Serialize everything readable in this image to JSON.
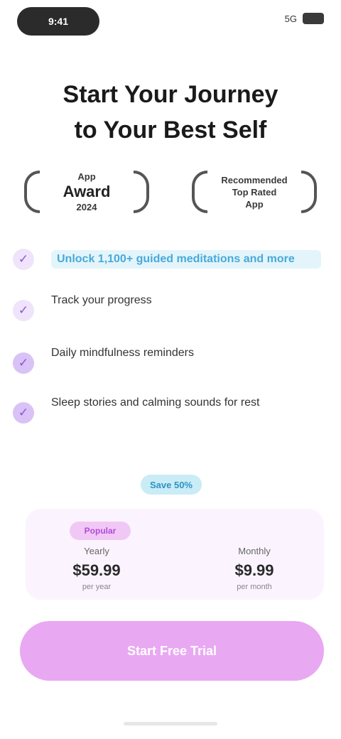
{
  "status_bar": {
    "time": "9:41",
    "signal": "5G"
  },
  "title": {
    "line1": "Start Your Journey",
    "line2": "to Your Best Self"
  },
  "awards": [
    {
      "line1": "App",
      "line2": "Award",
      "line3": "2024"
    },
    {
      "line1": "Recommended",
      "line2": "Top Rated",
      "line3": "App"
    }
  ],
  "features": [
    {
      "text": "Unlock 1,100+ guided meditations and more"
    },
    {
      "text": "Track your progress"
    },
    {
      "text": "Daily mindfulness reminders"
    },
    {
      "text": "Sleep stories and calming sounds for rest"
    }
  ],
  "badge": "Save 50%",
  "plans": [
    {
      "tag": "Popular",
      "name": "Yearly",
      "price": "$59.99",
      "sub": "per year"
    },
    {
      "tag": "",
      "name": "Monthly",
      "price": "$9.99",
      "sub": "per month"
    }
  ],
  "cta_label": "Start Free Trial",
  "colors": {
    "accent": "#e9a8f2",
    "highlight": "#4aa9d8",
    "check": "#8a55d6"
  }
}
